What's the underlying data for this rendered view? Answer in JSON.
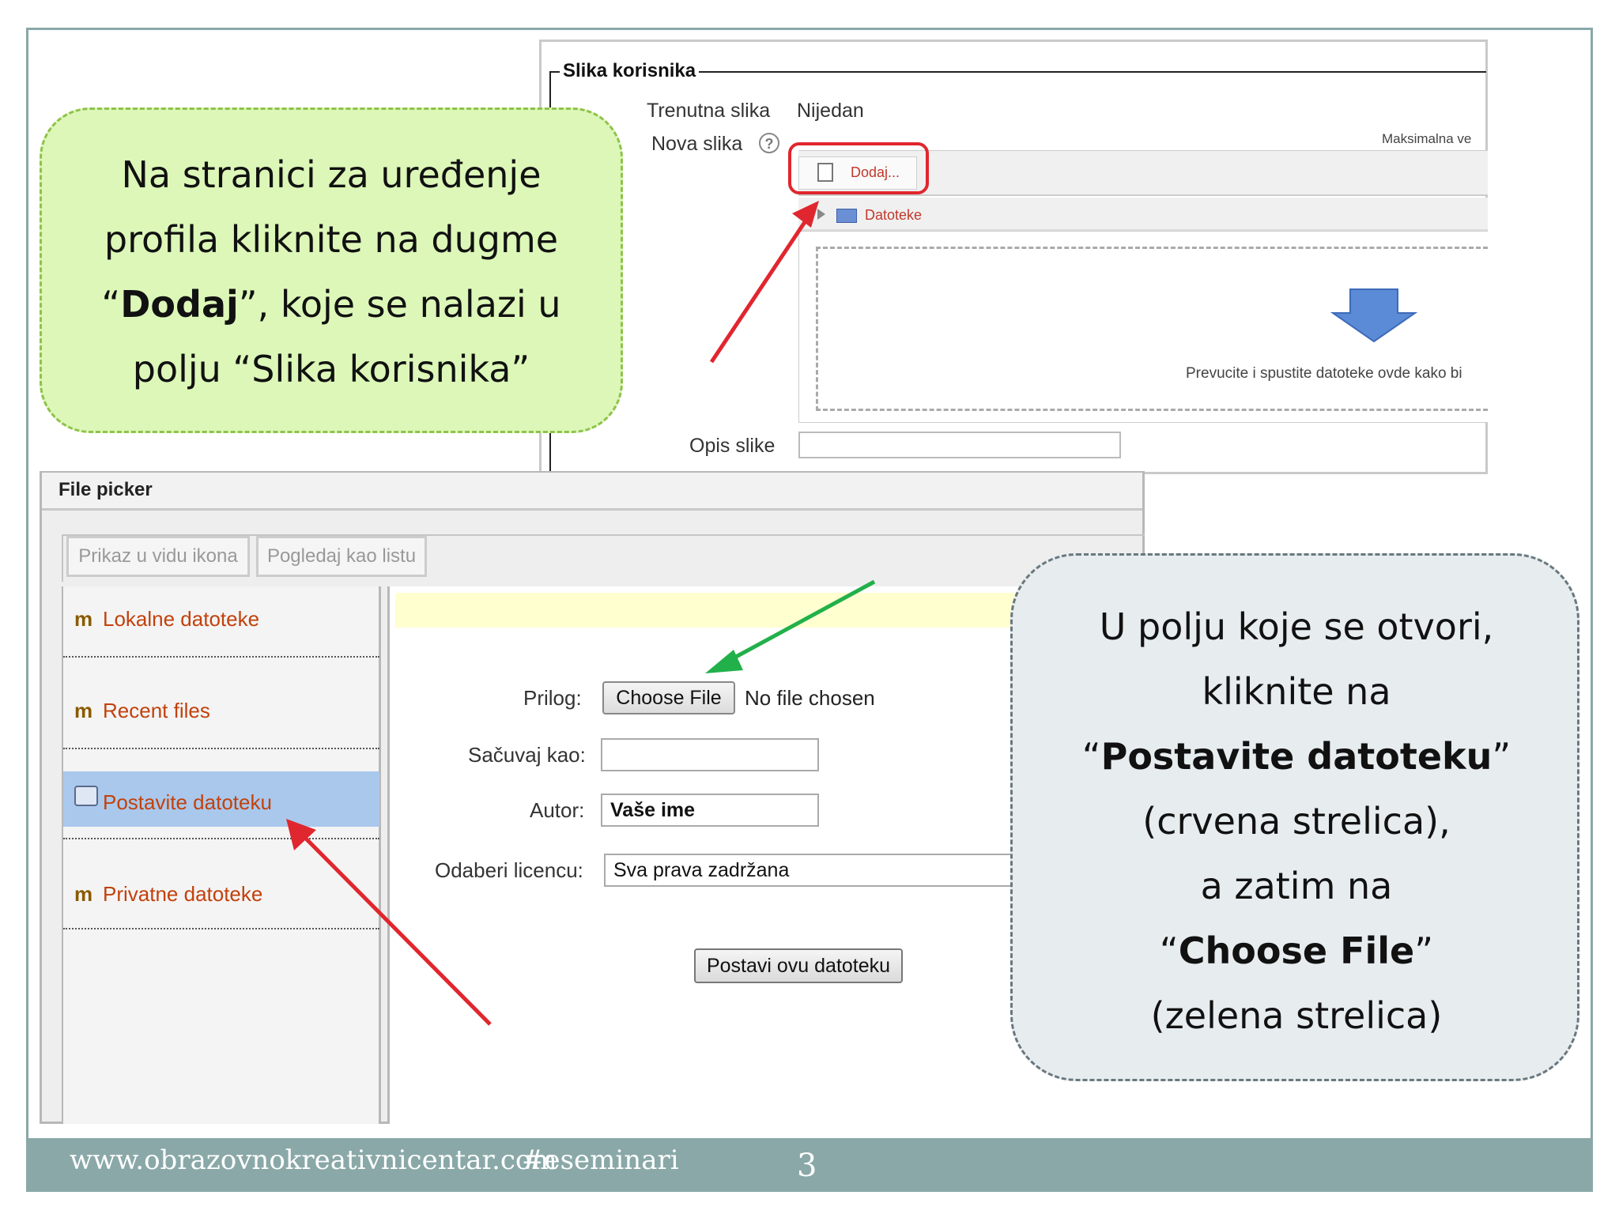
{
  "slide": {
    "footer_url": "www.obrazovnokreativnicentar.com",
    "footer_tag": "#eseminari",
    "page_number": "3"
  },
  "profile_form": {
    "legend": "Slika korisnika",
    "current_image_label": "Trenutna slika",
    "current_image_value": "Nijedan",
    "new_image_label": "Nova slika",
    "help_icon_glyph": "?",
    "max_size_text": "Maksimalna ve",
    "add_button_label": "Dodaj...",
    "path_folder_label": "Datoteke",
    "drop_hint": "Prevucite i spustite datoteke ovde kako bi",
    "description_label": "Opis slike",
    "description_value": ""
  },
  "green_callout": {
    "line1": "Na stranici za uređenje",
    "line2": "profila kliknite na dugme",
    "line3_open": "“",
    "line3_bold": "Dodaj",
    "line3_rest": "”, koje se nalazi u",
    "line4": "polju “Slika korisnika”"
  },
  "file_picker": {
    "title": "File picker",
    "view_tabs": [
      "Prikaz u vidu ikona",
      "Pogledaj kao listu"
    ],
    "repositories": [
      {
        "label": "Lokalne datoteke",
        "icon": "moodle-icon",
        "selected": false
      },
      {
        "label": "Recent files",
        "icon": "moodle-icon",
        "selected": false
      },
      {
        "label": "Postavite datoteku",
        "icon": "upload-icon",
        "selected": true
      },
      {
        "label": "Privatne datoteke",
        "icon": "moodle-icon",
        "selected": false
      }
    ],
    "attachment_label": "Prilog:",
    "choose_file_button": "Choose File",
    "no_file_text": "No file chosen",
    "save_as_label": "Sačuvaj kao:",
    "save_as_value": "",
    "author_label": "Autor:",
    "author_value": "Vaše ime",
    "license_label": "Odaberi licencu:",
    "license_value": "Sva prava zadržana",
    "upload_button": "Postavi ovu datoteku"
  },
  "grey_callout": {
    "line1": "U polju koje se otvori,",
    "line2": "kliknite na",
    "line3_open": "“",
    "line3_bold": "Postavite datoteku",
    "line3_close": "”",
    "line4": "(crvena strelica),",
    "line5": "a zatim na",
    "line6_open": "“",
    "line6_bold": "Choose File",
    "line6_close": "”",
    "line7": "(zelena strelica)"
  },
  "colors": {
    "footer_bar": "#8aa8a8",
    "green_callout_bg": "#dcf7b8",
    "grey_callout_bg": "#e7ecef",
    "red_arrow": "#e0262e",
    "green_arrow": "#22b04a",
    "link_orange": "#c2410c",
    "selected_item_bg": "#a9c8ec"
  }
}
